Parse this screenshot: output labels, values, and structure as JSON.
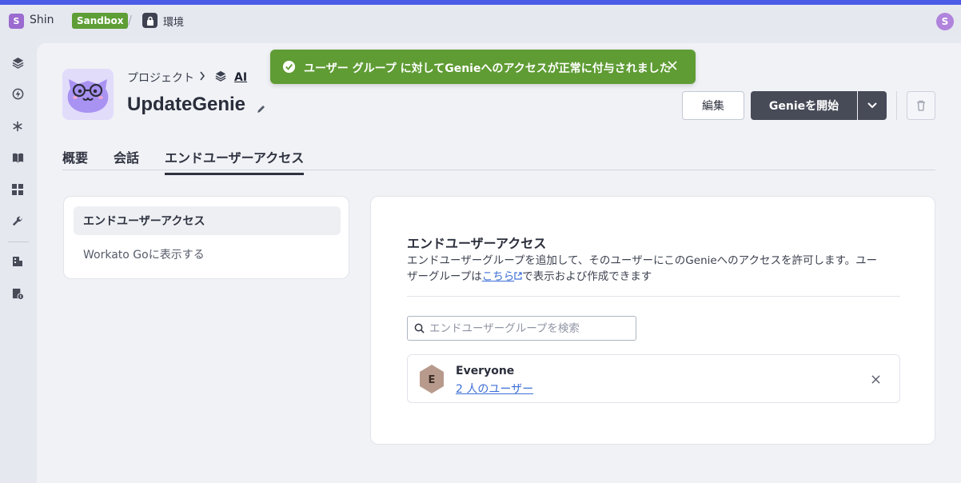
{
  "topbar": {
    "workspace_initial": "S",
    "workspace_name": "Shin",
    "sandbox_label": "Sandbox",
    "separator": "/",
    "environment_label": "環境",
    "user_initial": "S"
  },
  "project": {
    "breadcrumb_root": "プロジェクト",
    "breadcrumb_current": "AI",
    "title": "UpdateGenie"
  },
  "actions": {
    "edit_label": "編集",
    "start_label": "Genieを開始"
  },
  "tabs": [
    {
      "label": "概要",
      "active": false
    },
    {
      "label": "会話",
      "active": false
    },
    {
      "label": "エンドユーザーアクセス",
      "active": true
    }
  ],
  "side_menu": {
    "items": [
      {
        "label": "エンドユーザーアクセス",
        "active": true
      },
      {
        "label": "Workato Goに表示する",
        "active": false
      }
    ]
  },
  "access": {
    "title": "エンドユーザーアクセス",
    "desc_line1": "エンドユーザーグループを追加して、そのユーザーにこのGenieへのアクセスを許可します。ユー",
    "desc_line2_pre": "ザーグループは",
    "desc_link": "こちら",
    "desc_line2_post": "で表示および作成できます",
    "search_placeholder": "エンドユーザーグループを検索",
    "groups": [
      {
        "initial": "E",
        "name": "Everyone",
        "users_link": "2 人のユーザー"
      }
    ]
  },
  "toast": {
    "message": "ユーザー グループ に対してGenieへのアクセスが正常に付与されました"
  },
  "colors": {
    "accent_stripe": "#4b5be6",
    "sandbox": "#5e9e36",
    "toast": "#5f9c34",
    "primary_button": "#474b58",
    "link": "#3d6fd6",
    "avatar_hex": "#b89a8c"
  },
  "icons": {
    "sidebar": [
      "layers-icon",
      "lightning-icon",
      "snowflake-icon",
      "book-icon",
      "dashboard-icon",
      "wrench-icon",
      "building-icon",
      "billing-icon"
    ]
  }
}
